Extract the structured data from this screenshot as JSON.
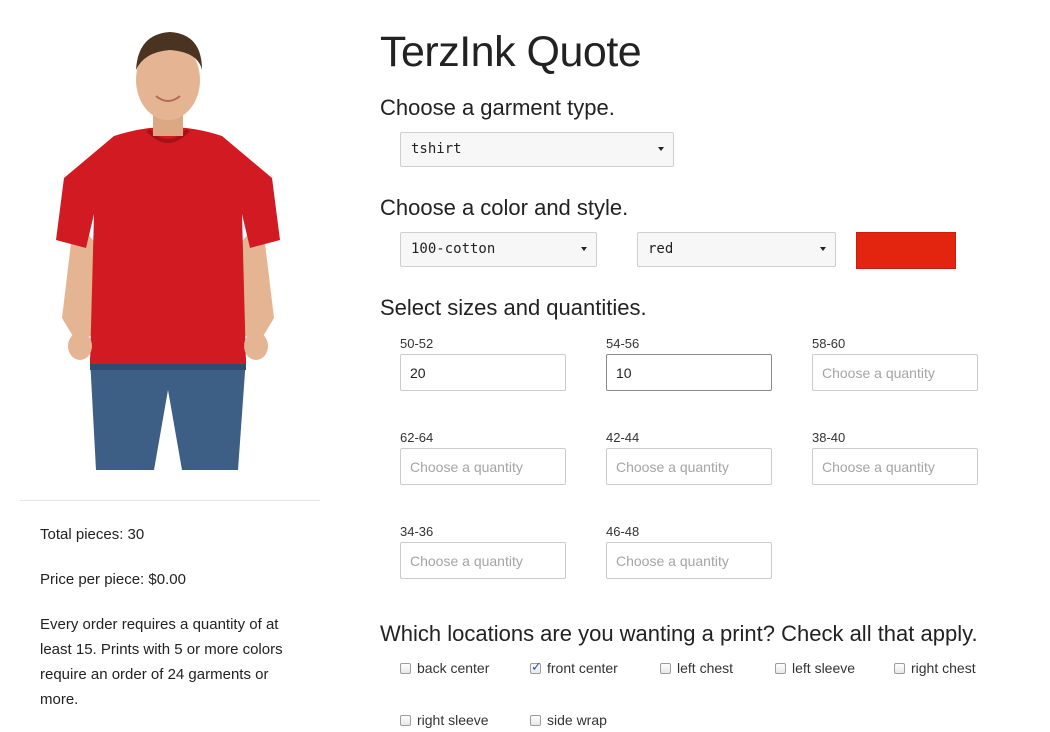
{
  "page": {
    "title": "TerzInk Quote"
  },
  "sections": {
    "garment": "Choose a garment type.",
    "color_style": "Choose a color and style.",
    "sizes": "Select sizes and quantities.",
    "locations": "Which locations are you wanting a print? Check all that apply."
  },
  "selects": {
    "garment_type": "tshirt",
    "style": "100-cotton",
    "color": "red",
    "swatch_color": "#e3240f"
  },
  "sizes": [
    {
      "label": "50-52",
      "value": "20",
      "placeholder": "Choose a quantity"
    },
    {
      "label": "54-56",
      "value": "10",
      "placeholder": "Choose a quantity"
    },
    {
      "label": "58-60",
      "value": "",
      "placeholder": "Choose a quantity"
    },
    {
      "label": "62-64",
      "value": "",
      "placeholder": "Choose a quantity"
    },
    {
      "label": "42-44",
      "value": "",
      "placeholder": "Choose a quantity"
    },
    {
      "label": "38-40",
      "value": "",
      "placeholder": "Choose a quantity"
    },
    {
      "label": "34-36",
      "value": "",
      "placeholder": "Choose a quantity"
    },
    {
      "label": "46-48",
      "value": "",
      "placeholder": "Choose a quantity"
    }
  ],
  "locations": [
    {
      "label": "back center",
      "checked": false
    },
    {
      "label": "front center",
      "checked": true
    },
    {
      "label": "left chest",
      "checked": false
    },
    {
      "label": "left sleeve",
      "checked": false
    },
    {
      "label": "right chest",
      "checked": false
    },
    {
      "label": "right sleeve",
      "checked": false
    },
    {
      "label": "side wrap",
      "checked": false
    }
  ],
  "summary": {
    "total_pieces": "Total pieces: 30",
    "price_per_piece": "Price per piece: $0.00",
    "note": "Every order requires a quantity of at least 15. Prints with 5 or more colors require an order of 24 garments or more."
  },
  "colors": {
    "shirt": "#d11a22",
    "jeans": "#3d5f86",
    "skin": "#e5b593",
    "hair": "#4a3321"
  }
}
